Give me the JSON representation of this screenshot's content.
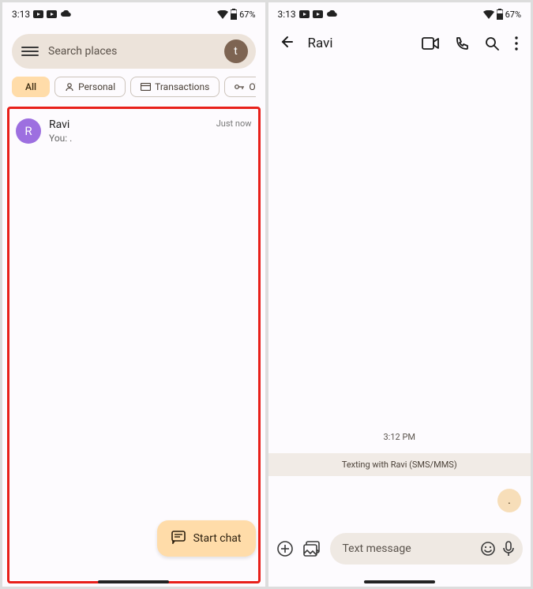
{
  "status": {
    "time": "3:13",
    "battery_pct": "67%"
  },
  "left": {
    "search_placeholder": "Search places",
    "avatar_letter": "t",
    "chips": [
      {
        "label": "All",
        "active": true
      },
      {
        "label": "Personal",
        "icon": "person"
      },
      {
        "label": "Transactions",
        "icon": "card"
      },
      {
        "label": "OTPs",
        "icon": "key"
      }
    ],
    "conversation": {
      "avatar_letter": "R",
      "name": "Ravi",
      "preview": "You: .",
      "time": "Just now"
    },
    "start_chat_label": "Start chat"
  },
  "right": {
    "title": "Ravi",
    "timestamp": "3:12 PM",
    "banner": "Texting with Ravi (SMS/MMS)",
    "sent_message": ".",
    "compose_placeholder": "Text message"
  }
}
